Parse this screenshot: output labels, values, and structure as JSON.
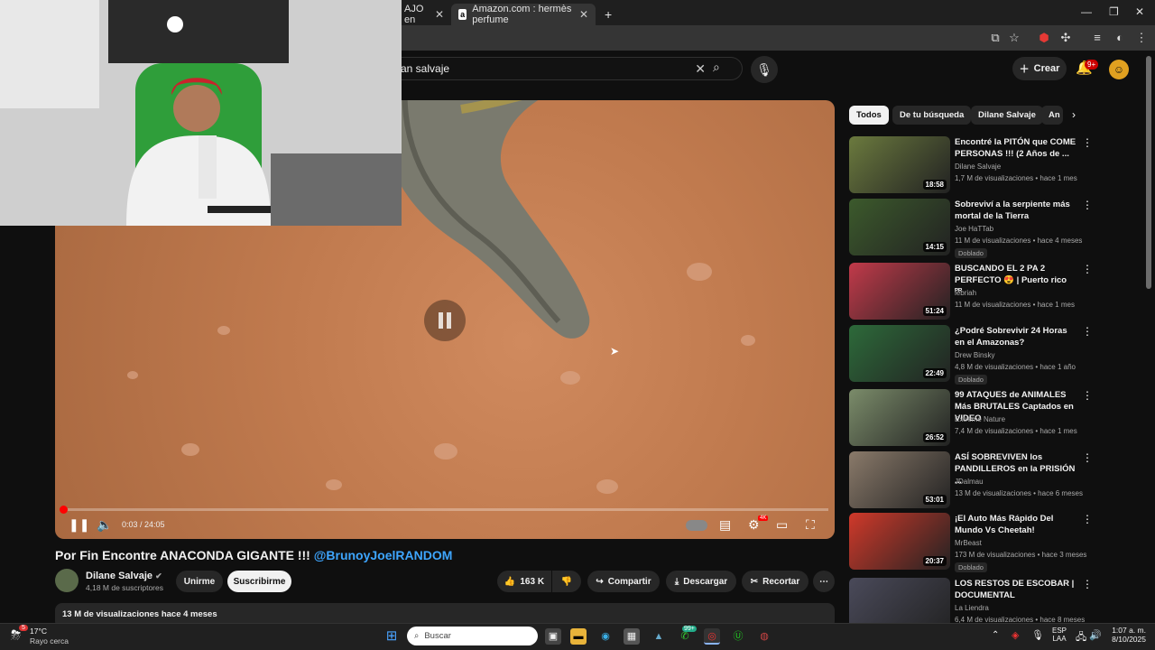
{
  "browser": {
    "tabs": [
      {
        "label": "AJO en",
        "active": false
      },
      {
        "label": "Amazon.com : hermès perfume",
        "active": true
      }
    ],
    "new_tab": "+"
  },
  "header": {
    "search_value": "an salvaje",
    "create_label": "Crear",
    "notifications_badge": "9+"
  },
  "player": {
    "time": "0:03 / 24:05",
    "progress": 0.002,
    "state": "paused",
    "settings_badge": "4K"
  },
  "video": {
    "title_plain": "Por Fin Encontre ANACONDA GIGANTE !!! ",
    "title_link": "@BrunoyJoelRANDOM",
    "channel": "Dilane Salvaje",
    "subscribers": "4,18 M de suscriptores",
    "join_label": "Unirme",
    "subscribe_label": "Suscribirme",
    "likes": "163 K",
    "share_label": "Compartir",
    "download_label": "Descargar",
    "clip_label": "Recortar",
    "views_date": "13 M de visualizaciones  hace 4 meses"
  },
  "chips": [
    "Todos",
    "De tu búsqueda",
    "Dilane Salvaje",
    "An"
  ],
  "recommendations": [
    {
      "title": "Encontré la PITÓN que COME PERSONAS !!! (2 Años de ...",
      "channel": "Dilane Salvaje",
      "meta": "1,7 M de visualizaciones • hace 1 mes",
      "duration": "18:58",
      "badge": "",
      "color": "#6b7a3e"
    },
    {
      "title": "Sobreviví a la serpiente más mortal de la Tierra",
      "channel": "Joe HaTTab",
      "meta": "11 M de visualizaciones • hace 4 meses",
      "duration": "14:15",
      "badge": "Doblado",
      "color": "#3c5a2c"
    },
    {
      "title": "BUSCANDO EL 2 PA 2 PERFECTO 😍 | Puerto rico ᴾᴿ",
      "channel": "lebriah",
      "meta": "11 M de visualizaciones • hace 1 mes",
      "duration": "51:24",
      "badge": "",
      "color": "#c23a4a"
    },
    {
      "title": "¿Podré Sobrevivir 24 Horas en el Amazonas?",
      "channel": "Drew Binsky",
      "meta": "4,8 M de visualizaciones • hace 1 año",
      "duration": "22:49",
      "badge": "Doblado",
      "color": "#2d6a3a"
    },
    {
      "title": "99 ATAQUES de ANIMALES Más BRUTALES Captados en VIDEO",
      "channel": "Extreme Nature",
      "meta": "7,4 M de visualizaciones • hace 1 mes",
      "duration": "26:52",
      "badge": "",
      "color": "#7b8c6a"
    },
    {
      "title": "ASÍ SOBREVIVEN los PANDILLEROS en la PRISIÓN ...",
      "channel": "JDalmau",
      "meta": "13 M de visualizaciones • hace 6 meses",
      "duration": "53:01",
      "badge": "",
      "color": "#8a7a6a"
    },
    {
      "title": "¡El Auto Más Rápido Del Mundo Vs Cheetah!",
      "channel": "MrBeast",
      "meta": "173 M de visualizaciones • hace 3 meses",
      "duration": "20:37",
      "badge": "Doblado",
      "color": "#d0392a"
    },
    {
      "title": "LOS RESTOS DE ESCOBAR | DOCUMENTAL",
      "channel": "La Liendra",
      "meta": "6,4 M de visualizaciones • hace 8 meses",
      "duration": "",
      "badge": "",
      "color": "#4a4a5a"
    }
  ],
  "taskbar": {
    "weather_temp": "17°C",
    "weather_desc": "Rayo cerca",
    "weather_badge": "5",
    "search_placeholder": "Buscar",
    "whatsapp_badge": "99+",
    "lang_top": "ESP",
    "lang_bottom": "LAA",
    "time": "1:07 a. m.",
    "date": "8/10/2025"
  },
  "colors": {
    "accent": "#ff0000",
    "link": "#3ea6ff",
    "background": "#0f0f0f"
  }
}
